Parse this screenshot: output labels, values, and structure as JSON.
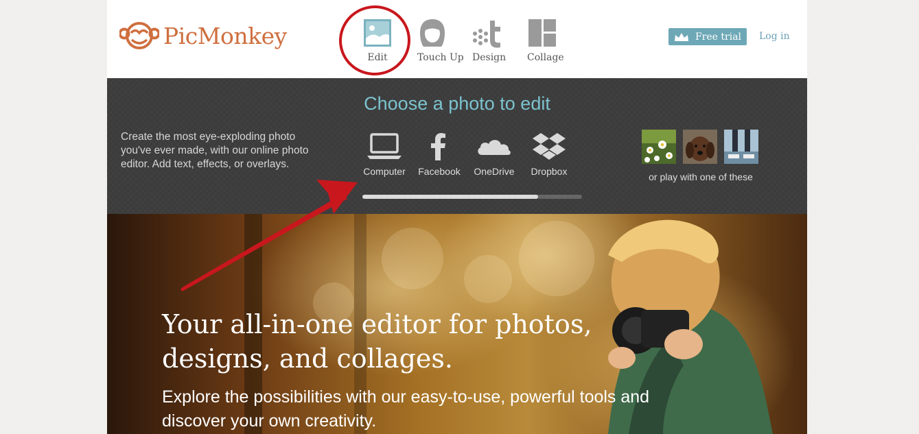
{
  "brand": {
    "name": "PicMonkey",
    "logo_color": "#cf6f3f"
  },
  "nav": {
    "items": [
      {
        "label": "Edit",
        "icon": "edit-photo-icon"
      },
      {
        "label": "Touch Up",
        "icon": "touch-up-face-icon"
      },
      {
        "label": "Design",
        "icon": "design-icon"
      },
      {
        "label": "Collage",
        "icon": "collage-icon"
      }
    ]
  },
  "header": {
    "free_trial_label": "Free trial",
    "login_label": "Log in"
  },
  "panel": {
    "title": "Choose a photo to edit",
    "description": "Create the most eye-exploding photo you've ever made, with our online photo editor. Add text, effects, or overlays.",
    "sources": [
      {
        "label": "Computer",
        "icon": "laptop-icon"
      },
      {
        "label": "Facebook",
        "icon": "facebook-icon"
      },
      {
        "label": "OneDrive",
        "icon": "onedrive-cloud-icon"
      },
      {
        "label": "Dropbox",
        "icon": "dropbox-icon"
      }
    ],
    "progress_fraction": 0.8,
    "samples_label": "or play with one of these"
  },
  "hero": {
    "title": "Your all-in-one editor for photos, designs, and collages.",
    "subtitle": "Explore the possibilities with our easy-to-use, powerful tools and discover your own creativity."
  },
  "colors": {
    "accent_teal": "#6ea8b6",
    "title_teal": "#7cc3cf",
    "annotation_red": "#c8171d",
    "panel_dark": "#3c3c3c"
  }
}
